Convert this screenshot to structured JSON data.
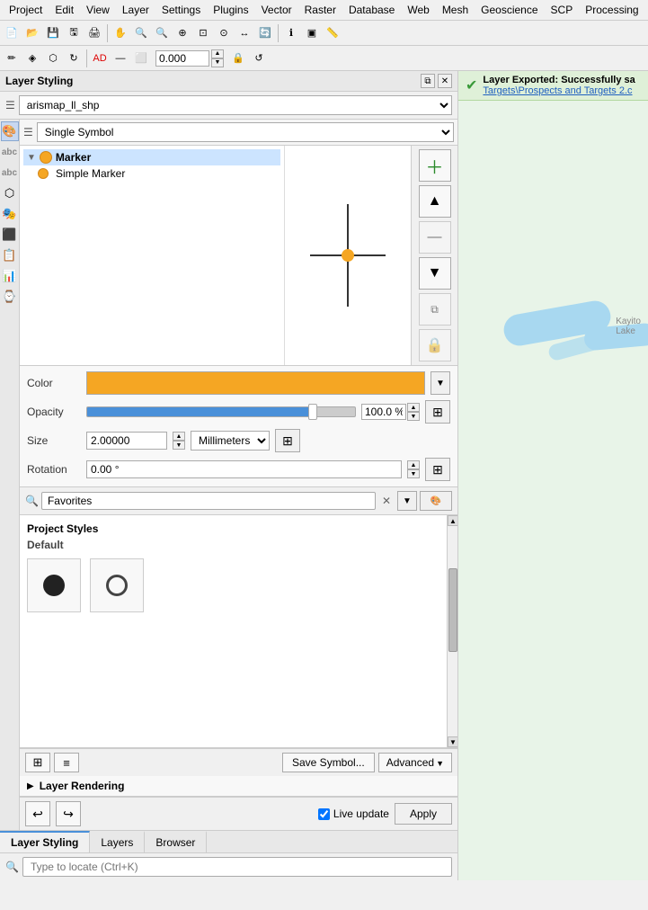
{
  "menubar": {
    "items": [
      "Project",
      "Edit",
      "View",
      "Layer",
      "Settings",
      "Plugins",
      "Vector",
      "Raster",
      "Database",
      "Web",
      "Mesh",
      "Geoscience",
      "SCP",
      "Processing"
    ]
  },
  "panel": {
    "title": "Layer Styling",
    "layer_name": "arismap_ll_shp",
    "symbol_type": "Single Symbol",
    "marker": {
      "label": "Marker",
      "sublabel": "Simple Marker"
    },
    "properties": {
      "color_label": "Color",
      "opacity_label": "Opacity",
      "opacity_value": "100.0 %",
      "size_label": "Size",
      "size_value": "2.00000",
      "size_unit": "Millimeters",
      "rotation_label": "Rotation",
      "rotation_value": "0.00 °"
    },
    "search_placeholder": "Favorites",
    "styles": {
      "heading": "Project Styles",
      "subheading": "Default"
    },
    "buttons": {
      "save_symbol": "Save Symbol...",
      "advanced": "Advanced",
      "layer_rendering": "Layer Rendering",
      "apply": "Apply",
      "live_update": "Live update"
    },
    "tabs": [
      {
        "label": "Layer Styling",
        "active": true
      },
      {
        "label": "Layers",
        "active": false
      },
      {
        "label": "Browser",
        "active": false
      }
    ],
    "search_bar_placeholder": "Type to locate (Ctrl+K)"
  },
  "notification": {
    "text": "Layer Exported: Successfully sa",
    "link": "Targets\\Prospects and Targets 2.c"
  },
  "icons": {
    "search": "🔍",
    "paint": "🎨",
    "add": "＋",
    "up": "▲",
    "down": "▼",
    "lock": "🔒",
    "copy": "⧉",
    "undo": "↩",
    "redo": "↪",
    "check": "✓",
    "arrow_right": "▶",
    "arrow_down": "▼"
  }
}
